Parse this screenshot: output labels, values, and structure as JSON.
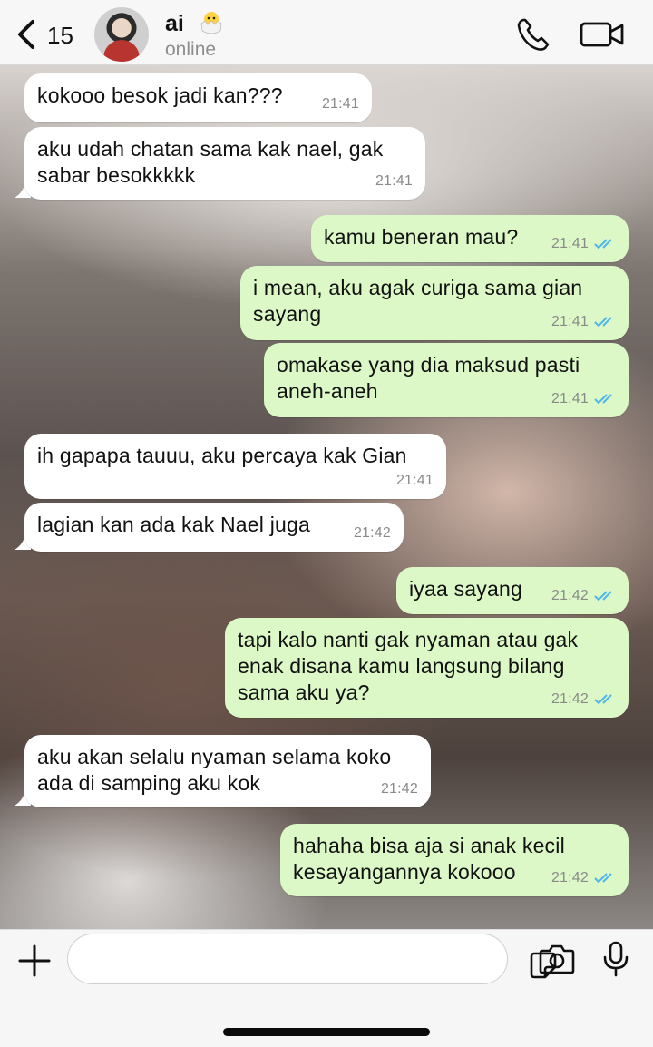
{
  "header": {
    "back_count": "15",
    "contact_name": "ai",
    "contact_emoji": "hatching-chick-icon",
    "status": "online",
    "icons": [
      "chevron-left-icon",
      "phone-icon",
      "video-camera-icon"
    ]
  },
  "messages": [
    {
      "dir": "in",
      "text": "kokooo besok jadi kan???",
      "time": "21:41"
    },
    {
      "dir": "in",
      "text": "aku udah chatan sama kak nael, gak sabar besokkkkk",
      "time": "21:41"
    },
    {
      "dir": "out",
      "text": "kamu beneran mau?",
      "time": "21:41",
      "status": "read"
    },
    {
      "dir": "out",
      "text": "i mean, aku agak curiga sama gian sayang",
      "time": "21:41",
      "status": "read"
    },
    {
      "dir": "out",
      "text": "omakase yang dia maksud pasti aneh-aneh",
      "time": "21:41",
      "status": "read"
    },
    {
      "dir": "in",
      "text": "ih gapapa tauuu, aku percaya kak Gian",
      "time": "21:41"
    },
    {
      "dir": "in",
      "text": "lagian kan ada kak Nael juga",
      "time": "21:42"
    },
    {
      "dir": "out",
      "text": "iyaa sayang",
      "time": "21:42",
      "status": "read"
    },
    {
      "dir": "out",
      "text": "tapi kalo nanti gak nyaman atau gak enak disana kamu langsung bilang sama aku ya?",
      "time": "21:42",
      "status": "read"
    },
    {
      "dir": "in",
      "text": "aku akan selalu nyaman selama koko ada di samping aku kok",
      "time": "21:42"
    },
    {
      "dir": "out",
      "text": "hahaha bisa aja si anak kecil kesayangannya kokooo",
      "time": "21:42",
      "status": "read"
    }
  ],
  "input": {
    "placeholder": "",
    "icons": [
      "plus-icon",
      "sticker-icon",
      "camera-icon",
      "microphone-icon"
    ]
  },
  "colors": {
    "incoming_bubble": "#ffffff",
    "outgoing_bubble": "#dcf8c6",
    "read_ticks": "#4fb6ec",
    "timestamp": "#8a8a8a"
  }
}
